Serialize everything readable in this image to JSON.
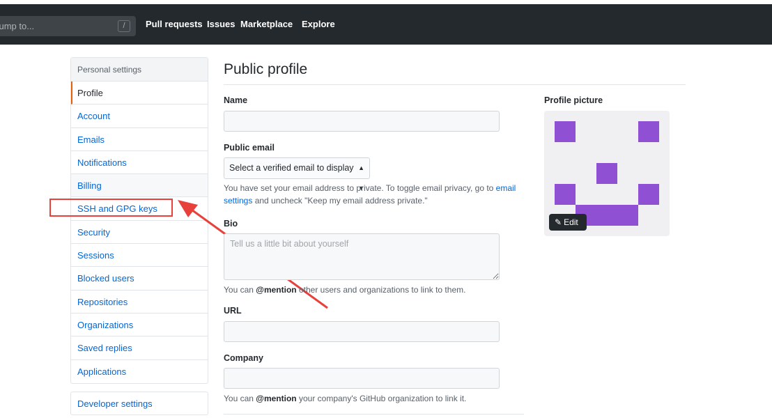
{
  "header": {
    "search_placeholder": "Jump to...",
    "search_shortcut": "/",
    "nav": [
      "Pull requests",
      "Issues",
      "Marketplace",
      "Explore"
    ]
  },
  "sidebar": {
    "title": "Personal settings",
    "items": [
      {
        "label": "Profile",
        "state": "selected"
      },
      {
        "label": "Account"
      },
      {
        "label": "Emails"
      },
      {
        "label": "Notifications"
      },
      {
        "label": "Billing",
        "state": "muted"
      },
      {
        "label": "SSH and GPG keys",
        "highlighted": true
      },
      {
        "label": "Security"
      },
      {
        "label": "Sessions"
      },
      {
        "label": "Blocked users"
      },
      {
        "label": "Repositories"
      },
      {
        "label": "Organizations"
      },
      {
        "label": "Saved replies"
      },
      {
        "label": "Applications"
      }
    ],
    "developer_settings": "Developer settings"
  },
  "main": {
    "title": "Public profile",
    "name_label": "Name",
    "name_value": "",
    "email_label": "Public email",
    "email_select": "Select a verified email to display",
    "email_note_1": "You have set your email address to private. To toggle email privacy, go to ",
    "email_note_link": "email settings",
    "email_note_2": " and uncheck \"Keep my email address private.\"",
    "bio_label": "Bio",
    "bio_placeholder": "Tell us a little bit about yourself",
    "bio_note_1": "You can ",
    "bio_note_mention": "@mention",
    "bio_note_2": " other users and organizations to link to them.",
    "url_label": "URL",
    "url_value": "",
    "company_label": "Company",
    "company_value": "",
    "company_note_1": "You can ",
    "company_note_mention": "@mention",
    "company_note_2": " your company's GitHub organization to link it."
  },
  "profile_picture": {
    "label": "Profile picture",
    "edit_label": "Edit",
    "avatar_color": "#8f50d4"
  },
  "annotation": {
    "color": "#e8403a"
  }
}
